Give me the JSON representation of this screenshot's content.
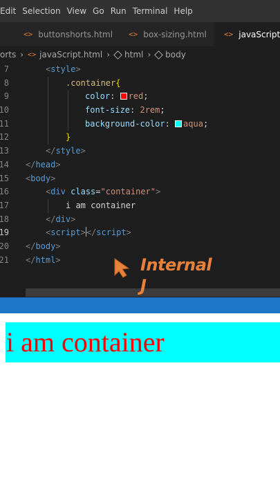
{
  "menu": {
    "items": [
      "Edit",
      "Selection",
      "View",
      "Go",
      "Run",
      "Terminal",
      "Help"
    ]
  },
  "tabs": [
    {
      "label": "buttonshorts.html",
      "icon": "<>"
    },
    {
      "label": "box-sizing.html",
      "icon": "<>"
    },
    {
      "label": "javaScript.htm",
      "icon": "<>"
    }
  ],
  "breadcrumb": {
    "folder": "orts",
    "file": "javaScript.html",
    "file_icon": "<>",
    "el1": "html",
    "el2": "body"
  },
  "editor": {
    "current_line": "19",
    "lines": [
      {
        "n": "7",
        "parts": [
          {
            "c": "br",
            "t": "<"
          },
          {
            "c": "tag",
            "t": "style"
          },
          {
            "c": "br",
            "t": ">"
          }
        ]
      },
      {
        "n": "8",
        "parts": [
          {
            "c": "sel",
            "t": ".container"
          },
          {
            "c": "brace",
            "t": "{"
          }
        ]
      },
      {
        "n": "9",
        "parts": [
          {
            "c": "prop",
            "t": "color"
          },
          {
            "c": "",
            "t": ": "
          },
          {
            "c": "val",
            "t": "red"
          },
          {
            "c": "",
            "t": ";"
          }
        ]
      },
      {
        "n": "10",
        "parts": [
          {
            "c": "prop",
            "t": "font-size"
          },
          {
            "c": "",
            "t": ": "
          },
          {
            "c": "val",
            "t": "2rem"
          },
          {
            "c": "",
            "t": ";"
          }
        ]
      },
      {
        "n": "11",
        "parts": [
          {
            "c": "prop",
            "t": "background-color"
          },
          {
            "c": "",
            "t": ": "
          },
          {
            "c": "val",
            "t": "aqua"
          },
          {
            "c": "",
            "t": ";"
          }
        ]
      },
      {
        "n": "12",
        "parts": [
          {
            "c": "brace",
            "t": "}"
          }
        ]
      },
      {
        "n": "13",
        "parts": [
          {
            "c": "br",
            "t": "</"
          },
          {
            "c": "tag",
            "t": "style"
          },
          {
            "c": "br",
            "t": ">"
          }
        ]
      },
      {
        "n": "14",
        "parts": [
          {
            "c": "br",
            "t": "</"
          },
          {
            "c": "tag",
            "t": "head"
          },
          {
            "c": "br",
            "t": ">"
          }
        ]
      },
      {
        "n": "15",
        "parts": [
          {
            "c": "br",
            "t": "<"
          },
          {
            "c": "tag",
            "t": "body"
          },
          {
            "c": "br",
            "t": ">"
          }
        ]
      },
      {
        "n": "16",
        "parts": [
          {
            "c": "br",
            "t": "<"
          },
          {
            "c": "tag",
            "t": "div"
          },
          {
            "c": "",
            "t": " "
          },
          {
            "c": "attr",
            "t": "class"
          },
          {
            "c": "",
            "t": "="
          },
          {
            "c": "val",
            "t": "\"container\""
          },
          {
            "c": "br",
            "t": ">"
          }
        ]
      },
      {
        "n": "17",
        "parts": [
          {
            "c": "",
            "t": "i am container"
          }
        ]
      },
      {
        "n": "18",
        "parts": [
          {
            "c": "br",
            "t": "</"
          },
          {
            "c": "tag",
            "t": "div"
          },
          {
            "c": "br",
            "t": ">"
          }
        ]
      },
      {
        "n": "19",
        "parts": [
          {
            "c": "br",
            "t": "<"
          },
          {
            "c": "tag",
            "t": "script"
          },
          {
            "c": "br",
            "t": ">"
          },
          {
            "c": "cursor",
            "t": ""
          },
          {
            "c": "br",
            "t": "</"
          },
          {
            "c": "tag",
            "t": "script"
          },
          {
            "c": "br",
            "t": ">"
          }
        ]
      },
      {
        "n": "20",
        "parts": [
          {
            "c": "br",
            "t": "</"
          },
          {
            "c": "tag",
            "t": "body"
          },
          {
            "c": "br",
            "t": ">"
          }
        ]
      },
      {
        "n": "21",
        "parts": [
          {
            "c": "br",
            "t": "</"
          },
          {
            "c": "tag",
            "t": "html"
          },
          {
            "c": "br",
            "t": ">"
          }
        ]
      }
    ],
    "swatches": {
      "red": "#ff0000",
      "aqua": "#00ffff"
    }
  },
  "overlay": {
    "line1": "Internal",
    "line2": "J",
    "color": "#e8813a"
  },
  "preview": {
    "text": "i am container",
    "text_color": "#ff0000",
    "background": "#00ffff"
  },
  "colors": {
    "editor_bg": "#1e1e1e",
    "blue_bar": "#1f75c8"
  }
}
